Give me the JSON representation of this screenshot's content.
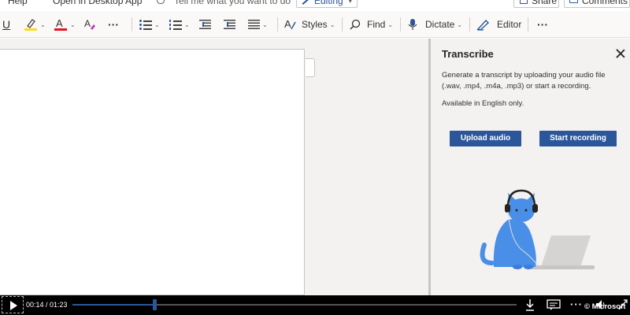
{
  "menubar": {
    "help": "Help",
    "open_desktop": "Open in Desktop App",
    "tell_me": "Tell me what you want to do",
    "editing": "Editing",
    "share": "Share",
    "comments": "Comments"
  },
  "ribbon": {
    "underline": "U",
    "more": "···",
    "styles": "Styles",
    "find": "Find",
    "dictate": "Dictate",
    "editor": "Editor",
    "more2": "···",
    "highlight_color": "#f6e01b",
    "font_color": "#e81123"
  },
  "transcribe": {
    "title": "Transcribe",
    "description": "Generate a transcript by uploading your audio file (.wav, .mp4, .m4a, .mp3) or start a recording.",
    "note": "Available in English only.",
    "upload_button": "Upload audio",
    "record_button": "Start recording",
    "accent_color": "#2b579a"
  },
  "player": {
    "time": "00:14 / 01:23",
    "progress_percent": 18.4,
    "copyright": "© Microsoft"
  }
}
